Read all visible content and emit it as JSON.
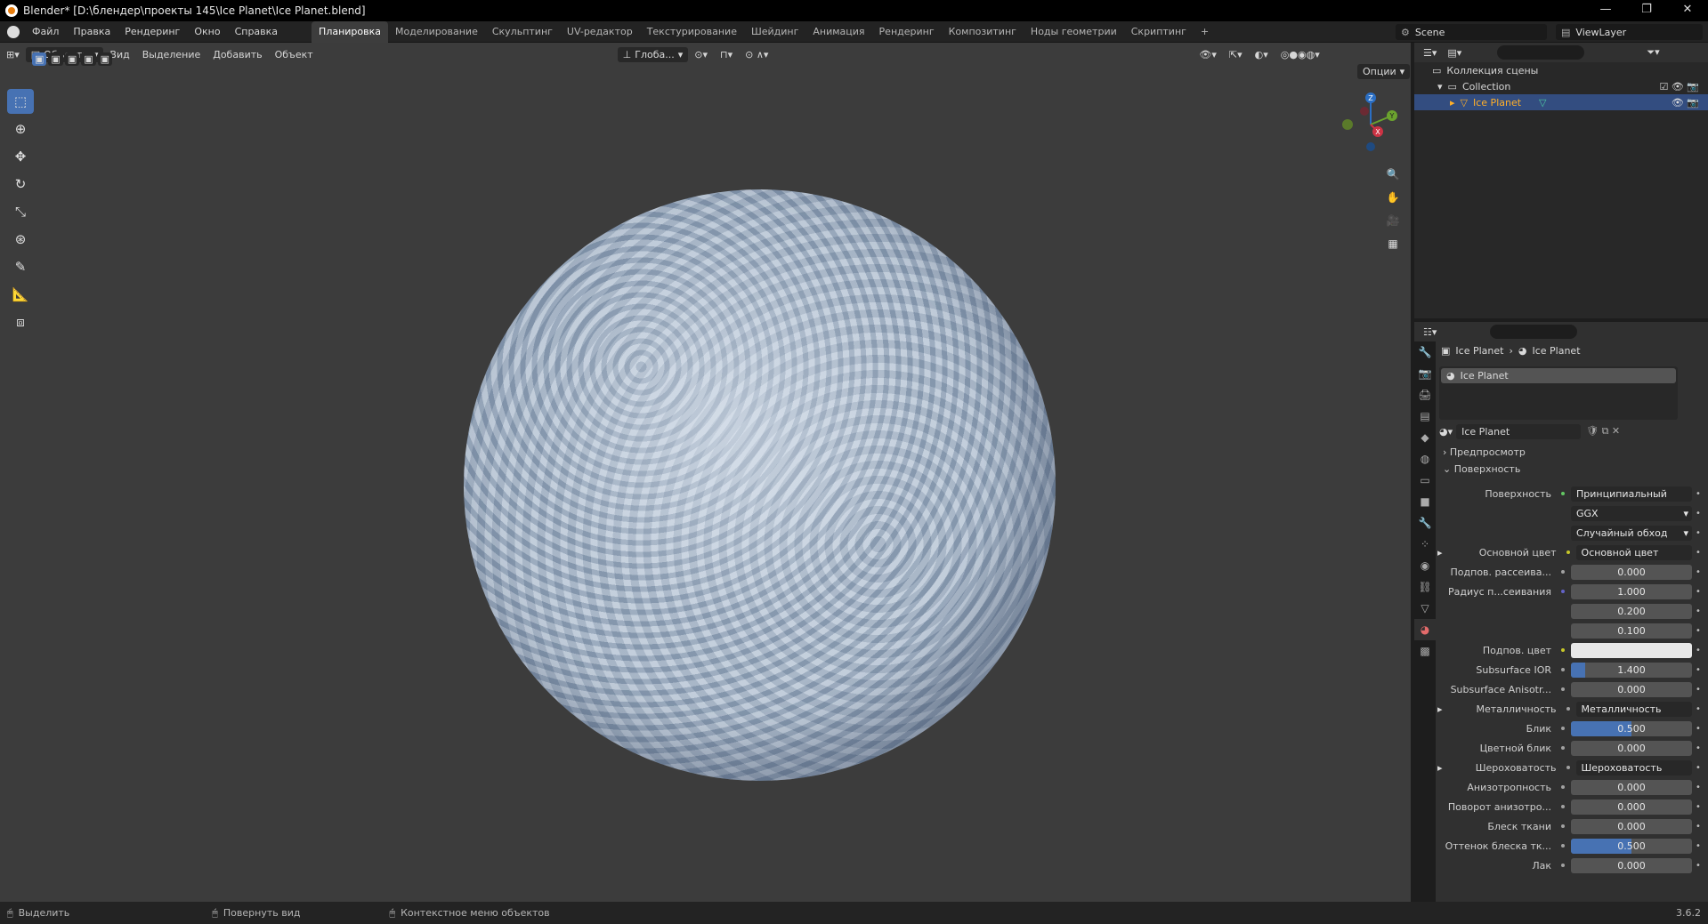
{
  "window": {
    "title": "Blender* [D:\\блендер\\проекты 145\\Ice Planet\\Ice Planet.blend]",
    "minimize": "—",
    "restore": "❐",
    "close": "✕"
  },
  "menu": [
    "Файл",
    "Правка",
    "Рендеринг",
    "Окно",
    "Справка"
  ],
  "workspaces": [
    "Планировка",
    "Моделирование",
    "Скульптинг",
    "UV-редактор",
    "Текстурирование",
    "Шейдинг",
    "Анимация",
    "Рендеринг",
    "Композитинг",
    "Ноды геометрии",
    "Скриптинг"
  ],
  "add_workspace": "+",
  "scene": "Scene",
  "view_layer": "ViewLayer",
  "viewport": {
    "mode": "Объекты",
    "menus": [
      "Вид",
      "Выделение",
      "Добавить",
      "Объект"
    ],
    "transform": "Глоба...",
    "options": "Опции"
  },
  "outliner": {
    "root": "Коллекция сцены",
    "collection": "Collection",
    "object": "Ice Planet"
  },
  "properties": {
    "breadcrumb": [
      "Ice Planet",
      "Ice Planet"
    ],
    "slot": "Ice Planet",
    "material": "Ice Planet",
    "panels": {
      "preview": "Предпросмотр",
      "surface": "Поверхность"
    },
    "rows": [
      {
        "label": "Поверхность",
        "value": "Принципиальный BSDF",
        "kind": "link",
        "dot": "g"
      },
      {
        "label": "",
        "value": "GGX",
        "kind": "select"
      },
      {
        "label": "",
        "value": "Случайный обход",
        "kind": "select"
      },
      {
        "label": "Основной цвет",
        "value": "Основной цвет",
        "kind": "link",
        "dot": "y",
        "expand": true
      },
      {
        "label": "Подпов. рассеива...",
        "value": "0.000",
        "kind": "num",
        "dot": "gr",
        "fill": 0
      },
      {
        "label": "Радиус п...сеивания",
        "value": "1.000",
        "kind": "num",
        "dot": "b",
        "fill": 0
      },
      {
        "label": "",
        "value": "0.200",
        "kind": "num",
        "fill": 0
      },
      {
        "label": "",
        "value": "0.100",
        "kind": "num",
        "fill": 0
      },
      {
        "label": "Подпов. цвет",
        "value": "",
        "kind": "color",
        "dot": "y"
      },
      {
        "label": "Subsurface IOR",
        "value": "1.400",
        "kind": "num",
        "dot": "gr",
        "fill": 0.12
      },
      {
        "label": "Subsurface Anisotr...",
        "value": "0.000",
        "kind": "num",
        "dot": "gr",
        "fill": 0
      },
      {
        "label": "Металличность",
        "value": "Металличность",
        "kind": "link",
        "dot": "gr",
        "expand": true
      },
      {
        "label": "Блик",
        "value": "0.500",
        "kind": "num",
        "dot": "gr",
        "fill": 0.5
      },
      {
        "label": "Цветной блик",
        "value": "0.000",
        "kind": "num",
        "dot": "gr",
        "fill": 0
      },
      {
        "label": "Шероховатость",
        "value": "Шероховатость",
        "kind": "link",
        "dot": "gr",
        "expand": true
      },
      {
        "label": "Анизотропность",
        "value": "0.000",
        "kind": "num",
        "dot": "gr",
        "fill": 0
      },
      {
        "label": "Поворот анизотро...",
        "value": "0.000",
        "kind": "num",
        "dot": "gr",
        "fill": 0
      },
      {
        "label": "Блеск ткани",
        "value": "0.000",
        "kind": "num",
        "dot": "gr",
        "fill": 0
      },
      {
        "label": "Оттенок блеска тк...",
        "value": "0.500",
        "kind": "num",
        "dot": "gr",
        "fill": 0.5
      },
      {
        "label": "Лак",
        "value": "0.000",
        "kind": "num",
        "dot": "gr",
        "fill": 0
      }
    ]
  },
  "status": {
    "select": "Выделить",
    "rotate": "Повернуть вид",
    "context": "Контекстное меню объектов",
    "version": "3.6.2"
  },
  "gizmo": {
    "z": "Z",
    "y": "Y",
    "x": "X"
  }
}
